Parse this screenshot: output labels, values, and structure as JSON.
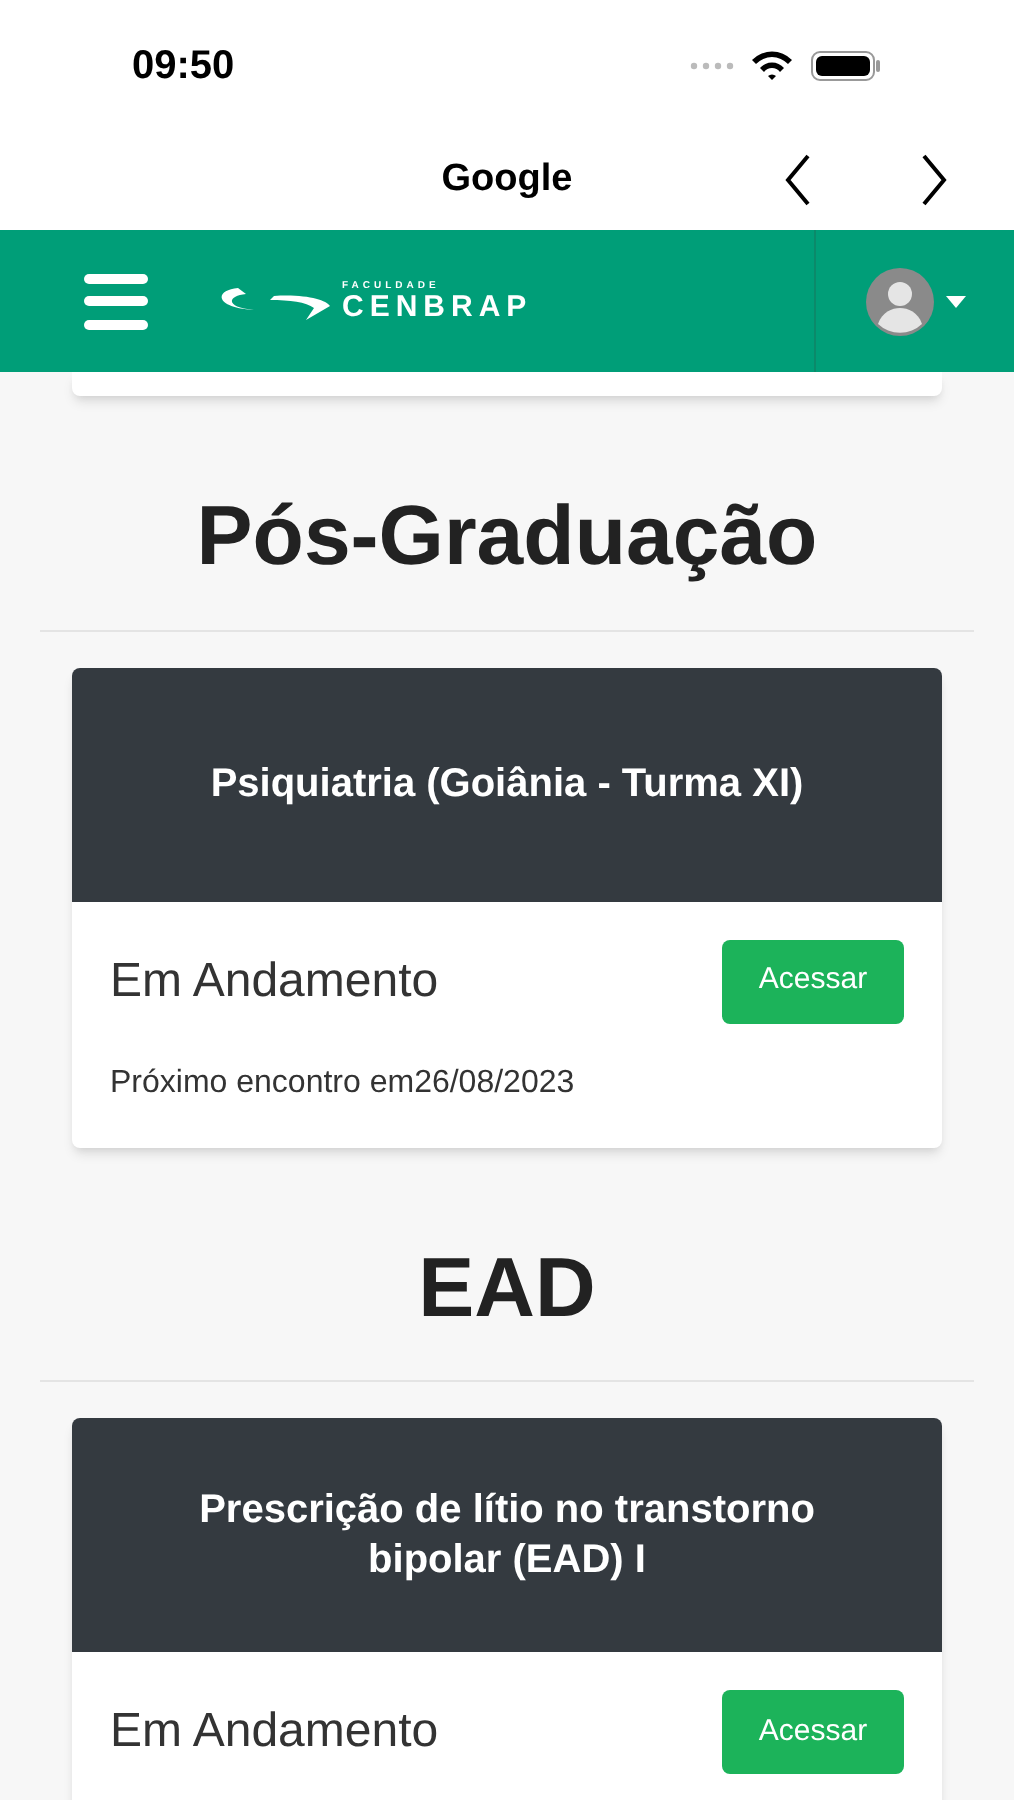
{
  "status_bar": {
    "time": "09:50"
  },
  "browser_bar": {
    "title": "Google"
  },
  "navbar": {
    "logo_small": "FACULDADE",
    "logo_main": "CENBRAP"
  },
  "sections": [
    {
      "title": "Pós-Graduação",
      "courses": [
        {
          "name": "Psiquiatria (Goiânia - Turma XI)",
          "status": "Em Andamento",
          "button": "Acessar",
          "note": "Próximo encontro em26/08/2023"
        }
      ]
    },
    {
      "title": "EAD",
      "courses": [
        {
          "name": "Prescrição de lítio no transtorno bipolar (EAD) I",
          "status": "Em Andamento",
          "button": "Acessar"
        }
      ]
    }
  ]
}
